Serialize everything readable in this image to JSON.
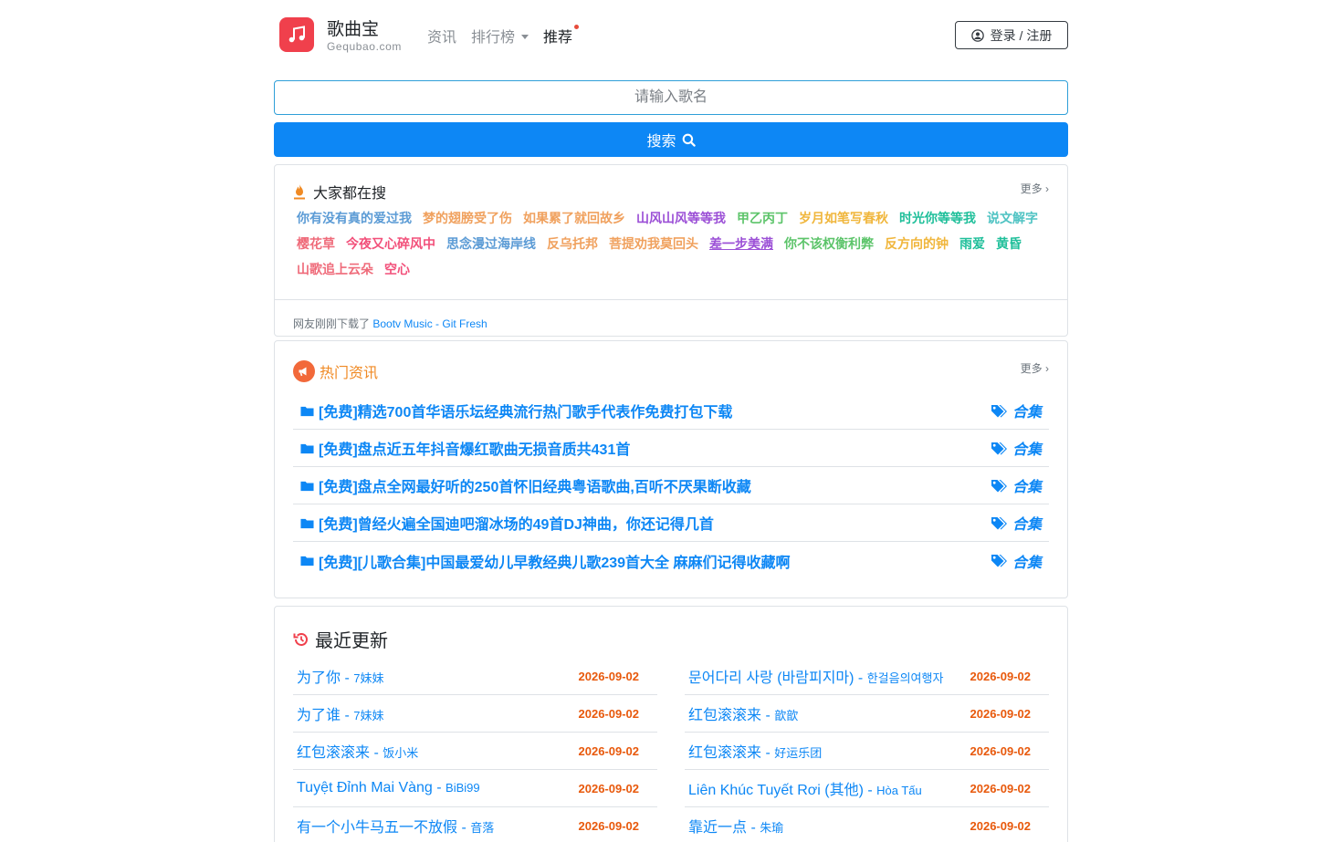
{
  "header": {
    "brand_name": "歌曲宝",
    "brand_domain": "Gequbao.com",
    "nav": [
      {
        "label": "资讯"
      },
      {
        "label": "排行榜"
      },
      {
        "label": "推荐"
      }
    ],
    "login_label": "登录 / 注册"
  },
  "search": {
    "placeholder": "请输入歌名",
    "button_label": "搜索"
  },
  "hot": {
    "title": "大家都在搜",
    "more": "更多 ›",
    "tags": [
      {
        "text": "你有没有真的爱过我",
        "color": "#5b9bd5"
      },
      {
        "text": "梦的翅膀受了伤",
        "color": "#f0a15e"
      },
      {
        "text": "如果累了就回故乡",
        "color": "#f0a15e"
      },
      {
        "text": "山风山风等等我",
        "color": "#9b4fd6"
      },
      {
        "text": "甲乙丙丁",
        "color": "#5cc46a"
      },
      {
        "text": "岁月如笔写春秋",
        "color": "#f0b63c"
      },
      {
        "text": "时光你等等我",
        "color": "#1fbf9a"
      },
      {
        "text": "说文解字",
        "color": "#4fc3c3"
      },
      {
        "text": "樱花草",
        "color": "#ef6b7a"
      },
      {
        "text": "今夜又心碎风中",
        "color": "#f2507a"
      },
      {
        "text": "思念漫过海岸线",
        "color": "#5b9bd5"
      },
      {
        "text": "反乌托邦",
        "color": "#f0a15e"
      },
      {
        "text": "菩提劝我莫回头",
        "color": "#f0a15e"
      },
      {
        "text": "差一步美满",
        "color": "#9b4fd6",
        "underline": true
      },
      {
        "text": "你不该权衡利弊",
        "color": "#5cc46a"
      },
      {
        "text": "反方向的钟",
        "color": "#f0b63c"
      },
      {
        "text": "雨爱",
        "color": "#1fbf9a"
      },
      {
        "text": "黄昏",
        "color": "#1fbf9a"
      },
      {
        "text": "山歌追上云朵",
        "color": "#ef6b7a"
      },
      {
        "text": "空心",
        "color": "#f2507a"
      }
    ],
    "download_prefix": "网友刚刚下载了",
    "download_song": "Bootv Music - Git Fresh"
  },
  "news": {
    "title": "热门资讯",
    "more": "更多 ›",
    "items": [
      {
        "title": "[免费]精选700首华语乐坛经典流行热门歌手代表作免费打包下载",
        "tag": "合集"
      },
      {
        "title": "[免费]盘点近五年抖音爆红歌曲无损音质共431首",
        "tag": "合集"
      },
      {
        "title": "[免费]盘点全网最好听的250首怀旧经典粤语歌曲,百听不厌果断收藏",
        "tag": "合集"
      },
      {
        "title": "[免费]曾经火遍全国迪吧溜冰场的49首DJ神曲，你还记得几首",
        "tag": "合集"
      },
      {
        "title": "[免费][儿歌合集]中国最爱幼儿早教经典儿歌239首大全 麻麻们记得收藏啊",
        "tag": "合集"
      }
    ]
  },
  "recent": {
    "title": "最近更新",
    "left": [
      {
        "song": "为了你",
        "artist": "7妹妹",
        "date": "2026-09-02"
      },
      {
        "song": "为了谁",
        "artist": "7妹妹",
        "date": "2026-09-02"
      },
      {
        "song": "红包滚滚来",
        "artist": "饭小米",
        "date": "2026-09-02"
      },
      {
        "song": "Tuyệt Đỉnh Mai Vàng",
        "artist": "BiBi99",
        "date": "2026-09-02"
      },
      {
        "song": "有一个小牛马五一不放假",
        "artist": "音落",
        "date": "2026-09-02"
      }
    ],
    "right": [
      {
        "song": "문어다리 사랑 (바람피지마)",
        "artist": "한걸음의여행자",
        "date": "2026-09-02"
      },
      {
        "song": "红包滚滚来",
        "artist": "歆歆",
        "date": "2026-09-02"
      },
      {
        "song": "红包滚滚来",
        "artist": "好运乐团",
        "date": "2026-09-02"
      },
      {
        "song": "Liên Khúc Tuyết Rơi (其他)",
        "artist": "Hòa Tấu",
        "date": "2026-09-02"
      },
      {
        "song": "靠近一点",
        "artist": "朱瑜",
        "date": "2026-09-02"
      }
    ]
  }
}
